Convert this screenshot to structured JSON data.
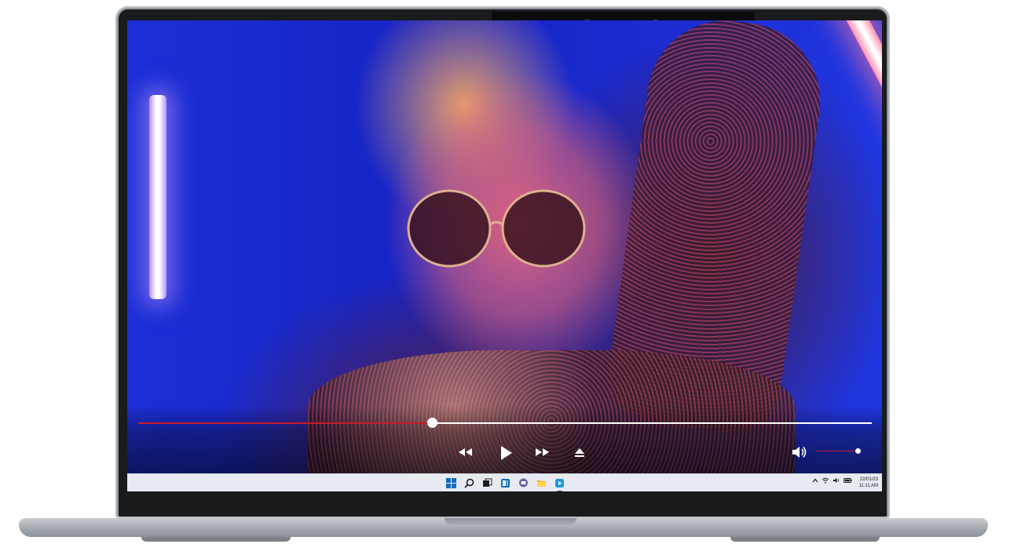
{
  "device": "laptop",
  "player": {
    "seek_progress": 0.4,
    "volume_level": 1.0,
    "controls": {
      "rewind_icon": "rewind-icon",
      "play_icon": "play-icon",
      "fast_forward_icon": "fast-forward-icon",
      "eject_icon": "eject-icon",
      "volume_icon": "volume-icon"
    },
    "accent_color": "#c61b2b"
  },
  "taskbar": {
    "apps": [
      {
        "name": "start-icon",
        "color": "#0f6cbd"
      },
      {
        "name": "search-icon",
        "color": "#1d1d1f"
      },
      {
        "name": "task-view-icon",
        "color": "#1d1d1f"
      },
      {
        "name": "widgets-icon",
        "color": "#0f6cbd"
      },
      {
        "name": "chat-icon",
        "color": "#6264a7"
      },
      {
        "name": "file-explorer-icon",
        "color": "#f2b622"
      },
      {
        "name": "media-player-icon",
        "color": "#1a9ad6",
        "active": true
      }
    ],
    "tray": {
      "chevron_icon": "chevron-up-icon",
      "wifi_icon": "wifi-icon",
      "volume_icon": "volume-icon",
      "battery_icon": "battery-icon"
    },
    "date": "22/01/23",
    "time": "11:11 AM"
  }
}
